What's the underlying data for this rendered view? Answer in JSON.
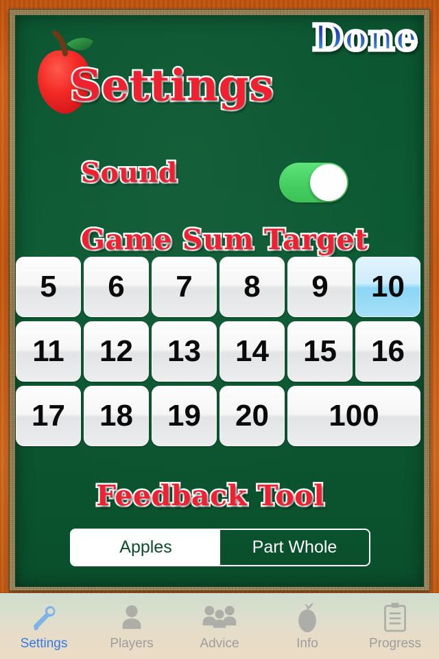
{
  "header": {
    "title": "Settings",
    "done_label": "Done",
    "logo_icon": "apple-icon"
  },
  "sound": {
    "label": "Sound",
    "toggle_state": "on",
    "toggle_on_color": "#46cf62"
  },
  "game_sum_target": {
    "label": "Game Sum Target",
    "selected": "10",
    "selected_color": "#8bd5f5",
    "options": [
      {
        "value": "5",
        "wide": false,
        "selected": false
      },
      {
        "value": "6",
        "wide": false,
        "selected": false
      },
      {
        "value": "7",
        "wide": false,
        "selected": false
      },
      {
        "value": "8",
        "wide": false,
        "selected": false
      },
      {
        "value": "9",
        "wide": false,
        "selected": false
      },
      {
        "value": "10",
        "wide": false,
        "selected": true
      },
      {
        "value": "11",
        "wide": false,
        "selected": false
      },
      {
        "value": "12",
        "wide": false,
        "selected": false
      },
      {
        "value": "13",
        "wide": false,
        "selected": false
      },
      {
        "value": "14",
        "wide": false,
        "selected": false
      },
      {
        "value": "15",
        "wide": false,
        "selected": false
      },
      {
        "value": "16",
        "wide": false,
        "selected": false
      },
      {
        "value": "17",
        "wide": false,
        "selected": false
      },
      {
        "value": "18",
        "wide": false,
        "selected": false
      },
      {
        "value": "19",
        "wide": false,
        "selected": false
      },
      {
        "value": "20",
        "wide": false,
        "selected": false
      },
      {
        "value": "100",
        "wide": true,
        "selected": false
      }
    ]
  },
  "feedback_tool": {
    "label": "Feedback Tool",
    "selected": "Apples",
    "segments": [
      {
        "label": "Apples",
        "selected": true
      },
      {
        "label": "Part Whole",
        "selected": false
      }
    ]
  },
  "tabbar": {
    "active": "Settings",
    "active_color": "#2f7ae5",
    "items": [
      {
        "label": "Settings",
        "icon": "wrench-icon",
        "active": true
      },
      {
        "label": "Players",
        "icon": "person-icon",
        "active": false
      },
      {
        "label": "Advice",
        "icon": "people-icon",
        "active": false
      },
      {
        "label": "Info",
        "icon": "apple-icon",
        "active": false
      },
      {
        "label": "Progress",
        "icon": "clipboard-icon",
        "active": false
      }
    ]
  },
  "theme": {
    "board_color": "#0b5631",
    "frame_color": "#a8956a",
    "wood_color": "#c65a12",
    "title_color": "#ef2030"
  }
}
